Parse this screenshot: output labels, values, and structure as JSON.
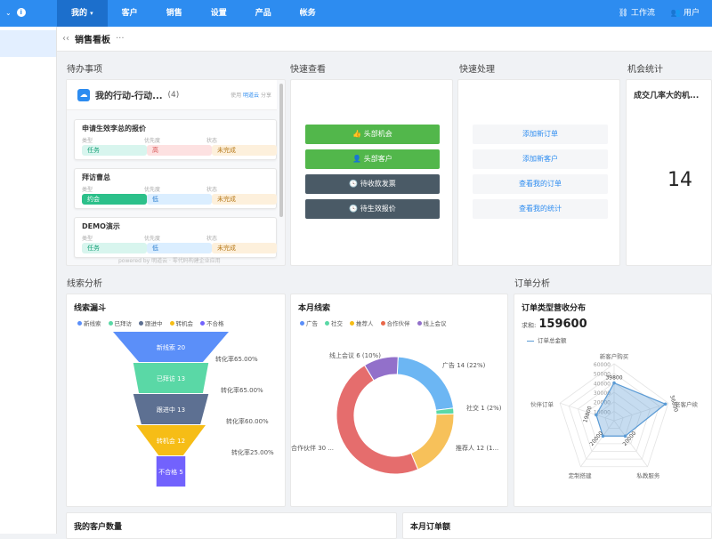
{
  "nav": {
    "items": [
      "我的",
      "客户",
      "销售",
      "设置",
      "产品",
      "帐务"
    ],
    "active": "我的",
    "right": [
      "工作流",
      "用户"
    ]
  },
  "breadcrumb": {
    "title": "销售看板",
    "more": "···"
  },
  "sections": {
    "todo": "待办事项",
    "quick_view": "快速查看",
    "quick_handle": "快速处理",
    "opportunity": "机会统计",
    "leads": "线索分析",
    "orders": "订单分析"
  },
  "todo": {
    "header": "我的行动-行动...",
    "count": "(4)",
    "powered_prefix": "使用",
    "powered_link": "明道云",
    "powered_suffix": "分享",
    "field_labels": [
      "类型",
      "优先度",
      "状态"
    ],
    "items": [
      {
        "title": "申请生效李总的报价",
        "type": "任务",
        "priority": "高",
        "status": "未完成"
      },
      {
        "title": "拜访曹总",
        "type": "约会",
        "priority": "低",
        "status": "未完成"
      },
      {
        "title": "DEMO演示",
        "type": "任务",
        "priority": "低",
        "status": "未完成"
      }
    ],
    "watermark": "powered by 明道云 · 零代码构建企业应用"
  },
  "quick_view": {
    "buttons": [
      "头部机会",
      "头部客户",
      "待收款发票",
      "待生效报价"
    ]
  },
  "quick_handle": {
    "buttons": [
      "添加新订单",
      "添加新客户",
      "查看我的订单",
      "查看我的统计"
    ]
  },
  "opportunity": {
    "title": "成交几率大的机...",
    "value": "14"
  },
  "funnel": {
    "title": "线索漏斗",
    "legend": [
      {
        "name": "新线索",
        "color": "#5b8ff9"
      },
      {
        "name": "已拜访",
        "color": "#5ad8a6"
      },
      {
        "name": "跟进中",
        "color": "#5d7092"
      },
      {
        "name": "转机会",
        "color": "#f6bd16"
      },
      {
        "name": "不合格",
        "color": "#7262fd"
      }
    ],
    "stages": [
      {
        "name": "新线索",
        "value": 20
      },
      {
        "name": "已拜访",
        "value": 13
      },
      {
        "name": "跟进中",
        "value": 13
      },
      {
        "name": "转机会",
        "value": 12
      },
      {
        "name": "不合格",
        "value": 5
      }
    ],
    "rates": [
      "转化率65.00%",
      "转化率65.00%",
      "转化率60.00%",
      "转化率25.00%"
    ]
  },
  "chart_data": [
    {
      "type": "funnel",
      "title": "线索漏斗",
      "categories": [
        "新线索",
        "已拜访",
        "跟进中",
        "转机会",
        "不合格"
      ],
      "values": [
        20,
        13,
        13,
        12,
        5
      ]
    },
    {
      "type": "pie",
      "title": "本月线索",
      "categories": [
        "广告",
        "社交",
        "推荐人",
        "合作伙伴",
        "线上会议"
      ],
      "values": [
        14,
        1,
        12,
        30,
        6
      ]
    },
    {
      "type": "radar",
      "title": "订单类型营收分布",
      "categories": [
        "新客户购买",
        "老客户续",
        "私教服务",
        "定制搭建",
        "伙伴订单"
      ],
      "values": [
        39800,
        56800,
        20000,
        20000,
        19800
      ],
      "ylim": [
        0,
        60000
      ],
      "series": [
        {
          "name": "订单总金额",
          "values": [
            39800,
            56800,
            20000,
            20000,
            19800
          ]
        }
      ]
    }
  ],
  "donut": {
    "title": "本月线索",
    "legend": [
      {
        "name": "广告",
        "color": "#5b8ff9"
      },
      {
        "name": "社交",
        "color": "#5ad8a6"
      },
      {
        "name": "推荐人",
        "color": "#f6bd16"
      },
      {
        "name": "合作伙伴",
        "color": "#e8684a"
      },
      {
        "name": "线上会议",
        "color": "#9270ca"
      }
    ],
    "labels": [
      "广告 14 (22%)",
      "社交  1 (2%)",
      "推荐人  12 (1...",
      "合作伙伴  30 ...",
      "线上会议  6 (10%)"
    ],
    "colors": [
      "#6cb6f3",
      "#5ad8a6",
      "#f7c15a",
      "#e56d6d",
      "#9270ca"
    ],
    "values": [
      14,
      1,
      12,
      30,
      6
    ]
  },
  "radar": {
    "title": "订单类型营收分布",
    "sum_label": "求和:",
    "sum_value": "159600",
    "series_name": "订单总金额",
    "axes": [
      "新客户购买",
      "老客户续",
      "私教服务",
      "定制搭建",
      "伙伴订单"
    ],
    "ticks": [
      "60000",
      "50000",
      "40000",
      "30000",
      "20000",
      "10000"
    ],
    "point_labels": [
      "39800",
      "56800",
      "20000",
      "20000",
      "19800"
    ]
  },
  "bottom": {
    "left": "我的客户数量",
    "right": "本月订单额"
  },
  "colors": {
    "primary": "#2d8cf0"
  }
}
